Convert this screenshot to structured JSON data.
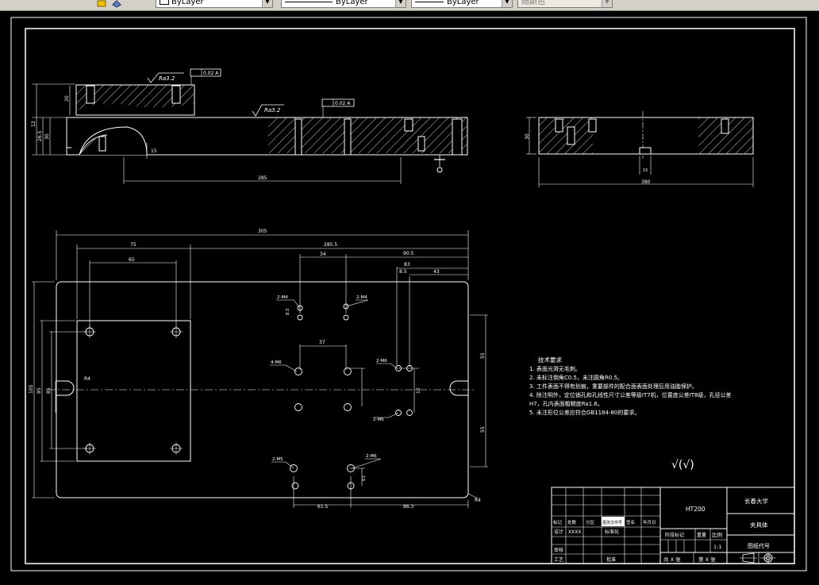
{
  "toolbar": {
    "layer_combo": "ByLayer",
    "linetype_combo": "ByLayer",
    "lineweight_combo": "ByLayer",
    "plotstyle_combo": "随颜色"
  },
  "drawing": {
    "top_view_roughness_a": "Ra3.2",
    "top_view_roughness_b": "Ra3.2",
    "flatness_a": "0.02 A",
    "flatness_b": "0.02 A",
    "dim_285": "285",
    "dim_380": "380",
    "dim_15": "15",
    "dim_15b": "15",
    "dim_12": "12",
    "dim_30": "30",
    "dim_26_5": "26.5",
    "dim_20": "20",
    "dim_305": "305",
    "dim_285_5": "285.5",
    "dim_75": "75",
    "dim_65": "65",
    "dim_34": "34",
    "dim_90_5": "90.5",
    "dim_83": "83",
    "dim_8_5": "8.5",
    "dim_43": "43",
    "dim_37": "37",
    "dim_61_5": "61.5",
    "dim_86_3": "86.3",
    "dim_55a": "55",
    "dim_55b": "55",
    "dim_10": "10",
    "dim_85": "85",
    "dim_105": "105",
    "dim_95": "95",
    "dim_r4": "R4",
    "dim_r4b": "R4",
    "label_2m4a": "2-M4",
    "label_2m4b": "2-M4",
    "label_4m6": "4-M6",
    "label_2m6a": "2-M6",
    "label_2m6b": "2-M6",
    "label_2m5": "2-M5",
    "label_2m6c": "2-M6",
    "label_8_5": "8.5",
    "label_61": "61"
  },
  "tech_notes": {
    "title": "技术要求",
    "lines": [
      "1. 表面光滑无毛刺。",
      "2. 未标注倒角C0.5，未注圆角R0.5。",
      "3. 工件表面不得有划痕，重要部件的配合面表面处理后用油脂保护。",
      "4. 除注明外，定位销孔和孔线性尺寸公差等级IT7机，位置度公差IT8级，孔径公差",
      "H7，孔内表面粗糙度Ra1.6。",
      "5. 未注形位公差应符合GB1184-80的要求。"
    ],
    "roughness_symbol": "√(√)"
  },
  "title_block": {
    "material": "HT200",
    "school": "长春大学",
    "part_name": "夹具体",
    "drawing_code": "图纸代号",
    "scale_label": "比例",
    "scale": "1:1",
    "stage": "阶段标记",
    "weight": "重量",
    "sheets_total": "共 X 张",
    "sheet_no": "第 X 张",
    "row_labels": [
      "标记",
      "处数",
      "分区",
      "更改文件号",
      "签名",
      "年月日"
    ],
    "design": "设计",
    "design_name": "XXXX",
    "standardize": "标准化",
    "review": "审核",
    "process": "工艺",
    "approve": "批准"
  }
}
